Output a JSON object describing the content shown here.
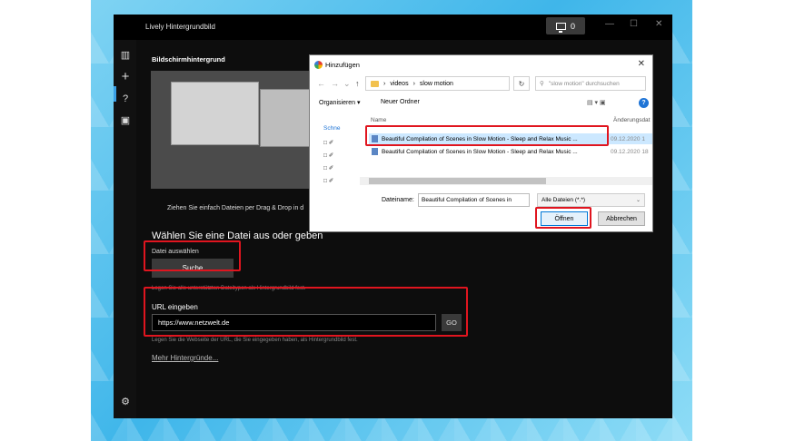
{
  "app": {
    "title": "Lively Hintergrundbild",
    "screen_count": "0",
    "minimize": "—",
    "maximize": "☐",
    "close": "✕",
    "sidebar_icons": [
      "library-icon",
      "add-icon",
      "help-icon",
      "feedback-icon",
      "settings-icon"
    ],
    "sidebar_glyphs": [
      "▥",
      "+",
      "?",
      "▣",
      "⚙"
    ]
  },
  "main": {
    "section_heading": "Bildschirmhintergrund",
    "drag_text": "Ziehen Sie einfach Dateien per Drag & Drop in d",
    "choose_heading": "Wählen Sie eine Datei aus oder geben",
    "file_label": "Datei auswählen",
    "search_button": "Suche",
    "file_hint": "Legen Sie alle unterstützten Dateitypen als Hintergrundbild fest.",
    "url_label": "URL eingeben",
    "url_value": "https://www.netzwelt.de",
    "go_button": "GO",
    "url_hint": "Legen Sie die Webseite der URL, die Sie eingegeben haben, als Hintergrundbild fest.",
    "more_link": "Mehr Hintergründe..."
  },
  "dialog": {
    "title": "Hinzufügen",
    "close": "✕",
    "nav_back": "←",
    "nav_forward": "→",
    "nav_dropdown": "⌄",
    "nav_up": "↑",
    "breadcrumb": [
      "videos",
      "slow motion"
    ],
    "breadcrumb_sep": "›",
    "refresh": "↻",
    "search_placeholder": "\"slow motion\" durchsuchen",
    "organize": "Organisieren ▾",
    "new_folder": "Neuer Ordner",
    "view_icons": "▤ ▾   ▣",
    "help": "?",
    "nav_items": [
      "Schne",
      "□ ✐",
      "□ ✐",
      "□ ✐",
      "□ ✐"
    ],
    "col_name": "Name",
    "col_date": "Änderungsdat",
    "files": [
      {
        "name": "Beautiful Compilation of Scenes in Slow Motion - Sleep and Relax Music ...",
        "date": "09.12.2020 1"
      },
      {
        "name": "Beautiful Compilation of Scenes in Slow Motion - Sleep and Relax Music ...",
        "date": "09.12.2020 18"
      }
    ],
    "filename_label": "Dateiname:",
    "filename_value": "Beautiful Compilation of Scenes in",
    "filetype": "Alle Dateien (*.*)",
    "open_button": "Öffnen",
    "cancel_button": "Abbrechen"
  },
  "colors": {
    "highlight": "#e0151f",
    "accent": "#0078d7",
    "selection": "#cce8ff"
  }
}
